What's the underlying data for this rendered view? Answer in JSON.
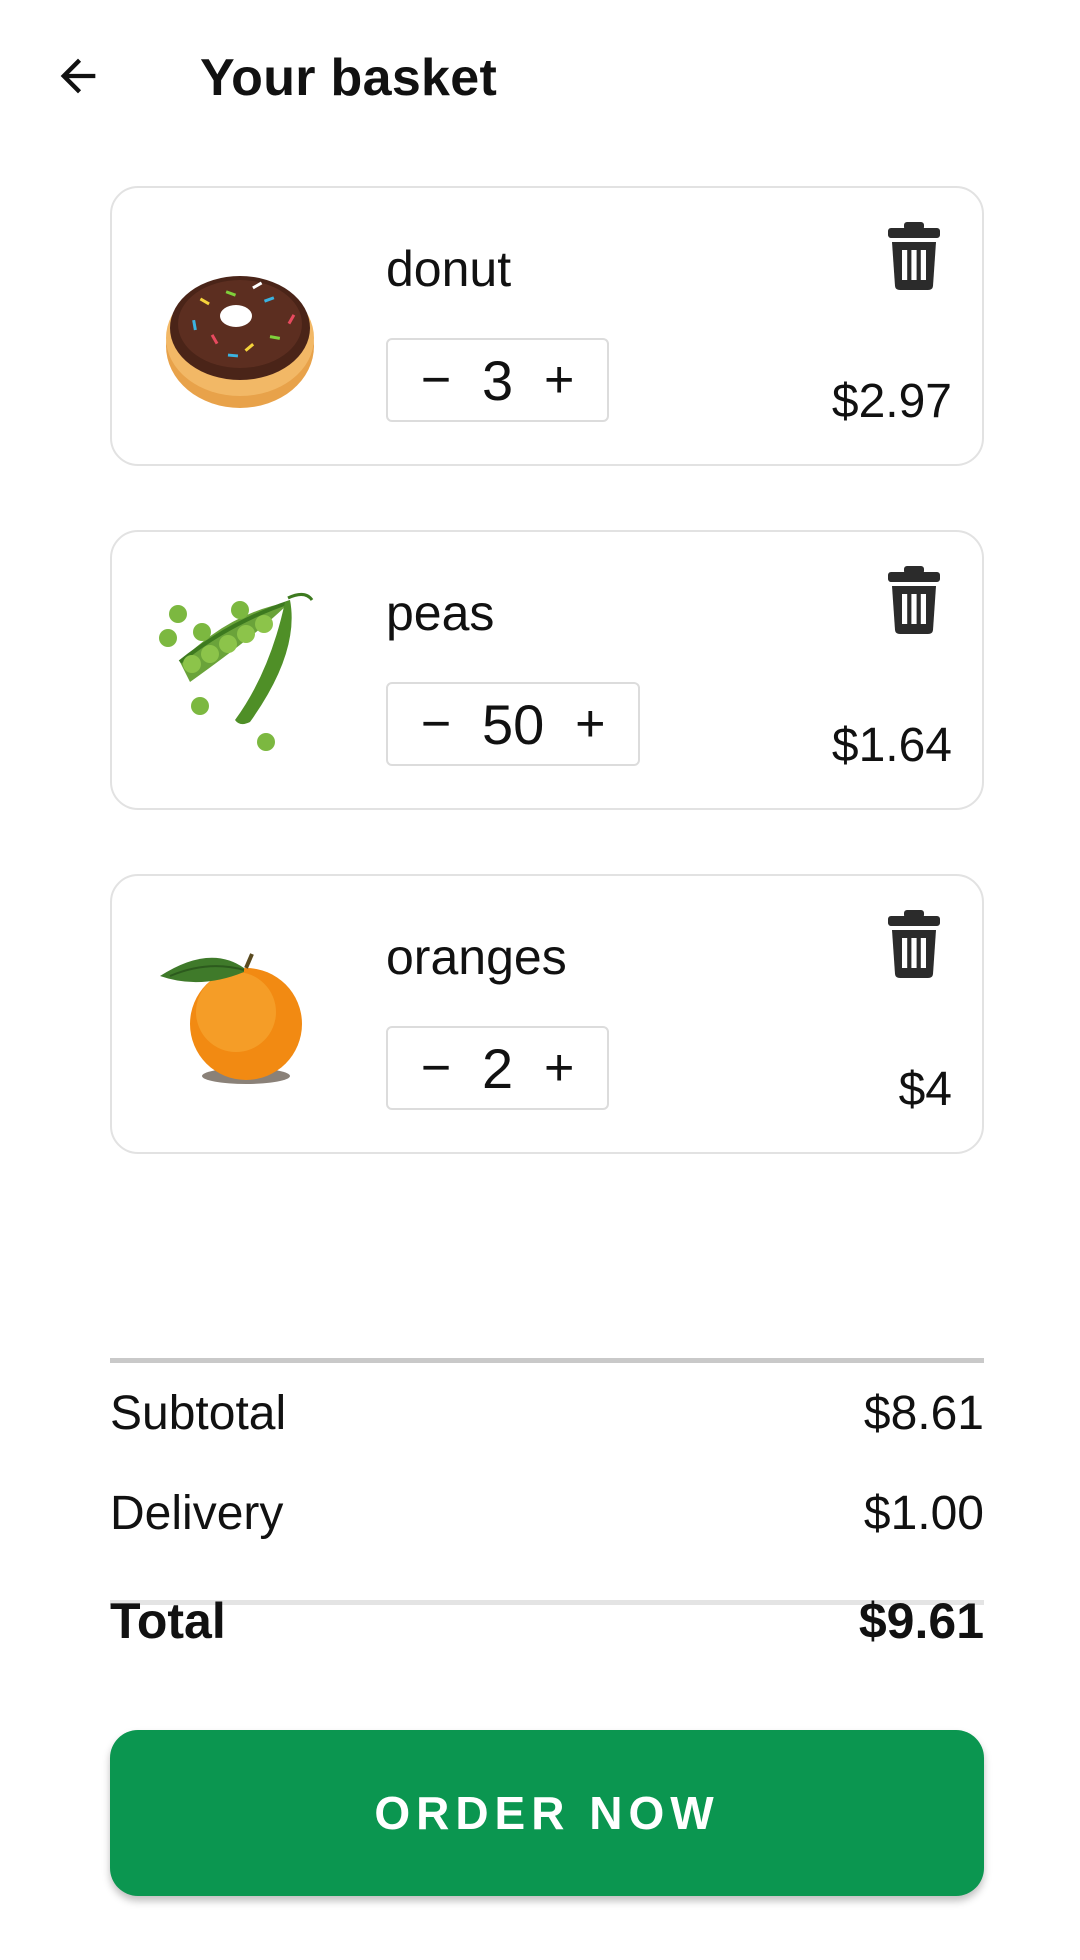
{
  "header": {
    "title": "Your basket",
    "back_icon": "arrow-left-icon"
  },
  "items": [
    {
      "name": "donut",
      "quantity": "3",
      "price": "$2.97",
      "image": "donut-image",
      "minus": "−",
      "plus": "+"
    },
    {
      "name": "peas",
      "quantity": "50",
      "price": "$1.64",
      "image": "peas-image",
      "minus": "−",
      "plus": "+"
    },
    {
      "name": "oranges",
      "quantity": "2",
      "price": "$4",
      "image": "orange-image",
      "minus": "−",
      "plus": "+"
    }
  ],
  "summary": {
    "subtotal_label": "Subtotal",
    "subtotal_value": "$8.61",
    "delivery_label": "Delivery",
    "delivery_value": "$1.00",
    "total_label": "Total",
    "total_value": "$9.61"
  },
  "order_button": {
    "label": "ORDER NOW"
  },
  "colors": {
    "accent": "#0b9650",
    "card_border": "#e2e2e2",
    "icon": "#2b2b2b"
  }
}
